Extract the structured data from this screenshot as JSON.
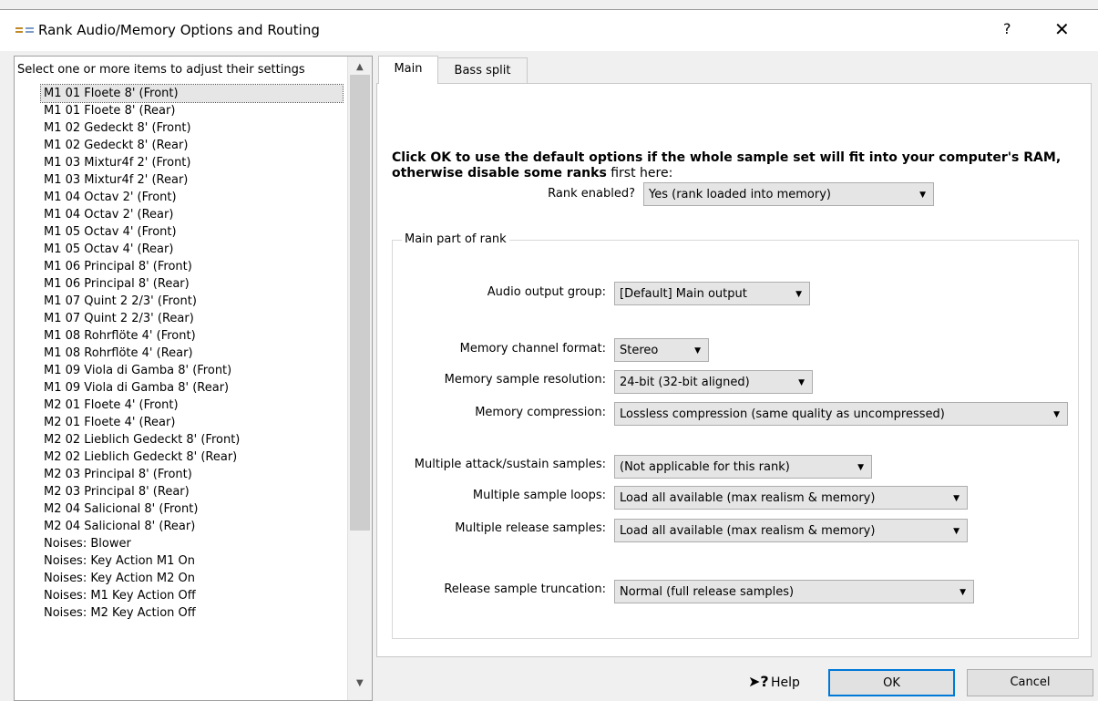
{
  "window": {
    "title": "Rank Audio/Memory Options and Routing",
    "help_glyph": "?",
    "close_glyph": "✕"
  },
  "list": {
    "header": "Select one or more items to adjust their settings",
    "items": [
      "M1 01 Floete 8' (Front)",
      "M1 01 Floete 8' (Rear)",
      "M1 02 Gedeckt 8' (Front)",
      "M1 02 Gedeckt 8' (Rear)",
      "M1 03 Mixtur4f 2' (Front)",
      "M1 03 Mixtur4f 2' (Rear)",
      "M1 04 Octav 2' (Front)",
      "M1 04 Octav 2' (Rear)",
      "M1 05 Octav 4' (Front)",
      "M1 05 Octav 4' (Rear)",
      "M1 06 Principal 8' (Front)",
      "M1 06 Principal 8' (Rear)",
      "M1 07 Quint 2 2/3' (Front)",
      "M1 07 Quint 2 2/3' (Rear)",
      "M1 08 Rohrflöte 4' (Front)",
      "M1 08 Rohrflöte 4' (Rear)",
      "M1 09 Viola di Gamba 8' (Front)",
      "M1 09 Viola di Gamba 8' (Rear)",
      "M2 01 Floete 4' (Front)",
      "M2 01 Floete 4' (Rear)",
      "M2 02 Lieblich Gedeckt 8' (Front)",
      "M2 02 Lieblich Gedeckt 8' (Rear)",
      "M2 03 Principal 8' (Front)",
      "M2 03 Principal 8' (Rear)",
      "M2 04 Salicional 8' (Front)",
      "M2 04 Salicional 8' (Rear)",
      "Noises: Blower",
      "Noises: Key Action M1 On",
      "Noises: Key Action M2 On",
      "Noises: M1 Key Action Off",
      "Noises: M2 Key Action Off"
    ],
    "selected_index": 0
  },
  "tabs": {
    "main": "Main",
    "bass_split": "Bass split"
  },
  "intro": {
    "bold": "Click OK to use the default options if the whole sample set will fit into your computer's RAM, otherwise disable some ranks",
    "normal": " first here:"
  },
  "rank_enabled": {
    "label": "Rank enabled?",
    "value": "Yes (rank loaded into memory)"
  },
  "group": {
    "legend": "Main part of rank"
  },
  "settings": {
    "audio_output_group": {
      "label": "Audio output group:",
      "value": "[Default] Main output"
    },
    "memory_channel_format": {
      "label": "Memory channel format:",
      "value": "Stereo"
    },
    "memory_sample_resolution": {
      "label": "Memory sample resolution:",
      "value": "24-bit (32-bit aligned)"
    },
    "memory_compression": {
      "label": "Memory compression:",
      "value": "Lossless compression (same quality as uncompressed)"
    },
    "multiple_attack_sustain": {
      "label": "Multiple attack/sustain samples:",
      "value": "(Not applicable for this rank)"
    },
    "multiple_sample_loops": {
      "label": "Multiple sample loops:",
      "value": "Load all available (max realism & memory)"
    },
    "multiple_release_samples": {
      "label": "Multiple release samples:",
      "value": "Load all available (max realism & memory)"
    },
    "release_sample_truncation": {
      "label": "Release sample truncation:",
      "value": "Normal (full release samples)"
    }
  },
  "buttons": {
    "help": "Help",
    "help_icon": "pointer-help-icon",
    "ok": "OK",
    "cancel": "Cancel"
  }
}
